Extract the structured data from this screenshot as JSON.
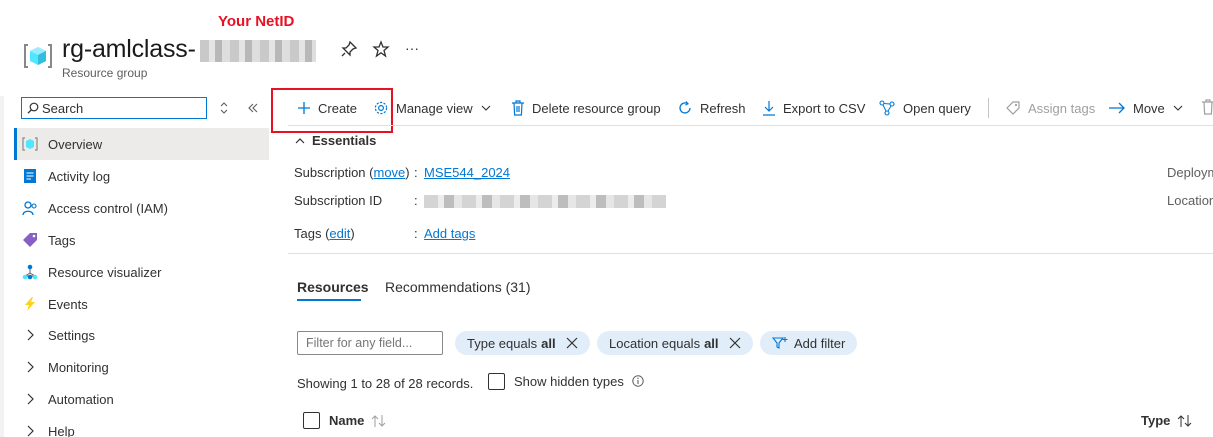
{
  "annotation": {
    "label": "Your  NetID",
    "color": "#e81123"
  },
  "header": {
    "title": "rg-amlclass-",
    "subtitle": "Resource group",
    "pin_icon": "pin-icon",
    "star_icon": "star-icon",
    "more_label": "···"
  },
  "search": {
    "value": "Search",
    "placeholder": "Search"
  },
  "sidebar": {
    "items": [
      {
        "label": "Overview",
        "icon": "resource-group-icon",
        "active": true
      },
      {
        "label": "Activity log",
        "icon": "activity-log-icon"
      },
      {
        "label": "Access control (IAM)",
        "icon": "people-icon"
      },
      {
        "label": "Tags",
        "icon": "tag-icon"
      },
      {
        "label": "Resource visualizer",
        "icon": "visualizer-icon"
      },
      {
        "label": "Events",
        "icon": "lightning-icon"
      },
      {
        "label": "Settings",
        "icon": "chevron-right-icon"
      },
      {
        "label": "Monitoring",
        "icon": "chevron-right-icon"
      },
      {
        "label": "Automation",
        "icon": "chevron-right-icon"
      },
      {
        "label": "Help",
        "icon": "chevron-right-icon"
      }
    ]
  },
  "toolbar": {
    "create": "Create",
    "manage_view": "Manage view",
    "delete_rg": "Delete resource group",
    "refresh": "Refresh",
    "export_csv": "Export to CSV",
    "open_query": "Open query",
    "assign_tags": "Assign tags",
    "move": "Move"
  },
  "essentials": {
    "heading": "Essentials",
    "subscription_label": "Subscription",
    "subscription_move": "move",
    "subscription_value": "MSE544_2024",
    "subscription_id_label": "Subscription ID",
    "tags_label": "Tags",
    "tags_edit": "edit",
    "tags_value": "Add tags",
    "colon": ":",
    "deployments_label": "Deploym",
    "location_label": "Location"
  },
  "tabs": [
    {
      "label": "Resources",
      "active": true
    },
    {
      "label": "Recommendations (31)",
      "active": false
    }
  ],
  "filters": {
    "filter_placeholder": "Filter for any field...",
    "type_pill": {
      "prefix": "Type equals",
      "value": "all"
    },
    "location_pill": {
      "prefix": "Location equals",
      "value": "all"
    },
    "add_filter": "Add filter"
  },
  "records": {
    "showing": "Showing 1 to 28 of 28 records.",
    "show_hidden": "Show hidden types"
  },
  "table": {
    "columns": [
      "Name",
      "Type"
    ]
  },
  "colors": {
    "accent": "#0078d4",
    "pill_bg": "#e1eefa",
    "active_bg": "#edebe9"
  }
}
